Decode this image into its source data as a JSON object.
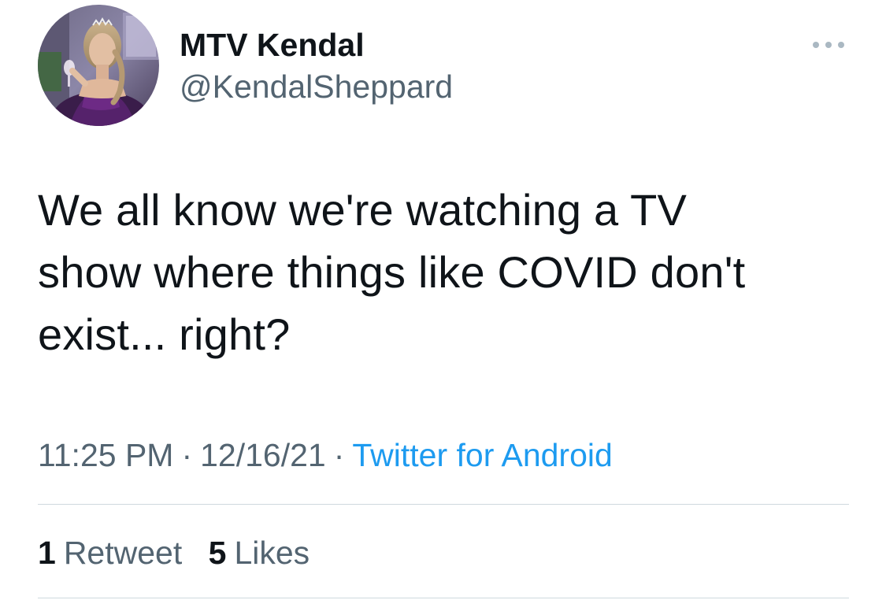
{
  "user": {
    "display_name": "MTV Kendal",
    "handle": "@KendalSheppard"
  },
  "tweet": {
    "text_lines": [
      "We all know we're watching a TV",
      "show where things like COVID don't",
      "exist... right?"
    ],
    "time": "11:25 PM",
    "date": "12/16/21",
    "separator": "·",
    "source": "Twitter for Android"
  },
  "stats": {
    "retweets_count": "1",
    "retweets_label": "Retweet",
    "likes_count": "5",
    "likes_label": "Likes"
  },
  "icons": {
    "more": "more-dots-icon"
  },
  "colors": {
    "text_primary": "#0f1419",
    "text_secondary": "#536471",
    "link": "#1d9bf0",
    "divider": "#cfd9de"
  }
}
